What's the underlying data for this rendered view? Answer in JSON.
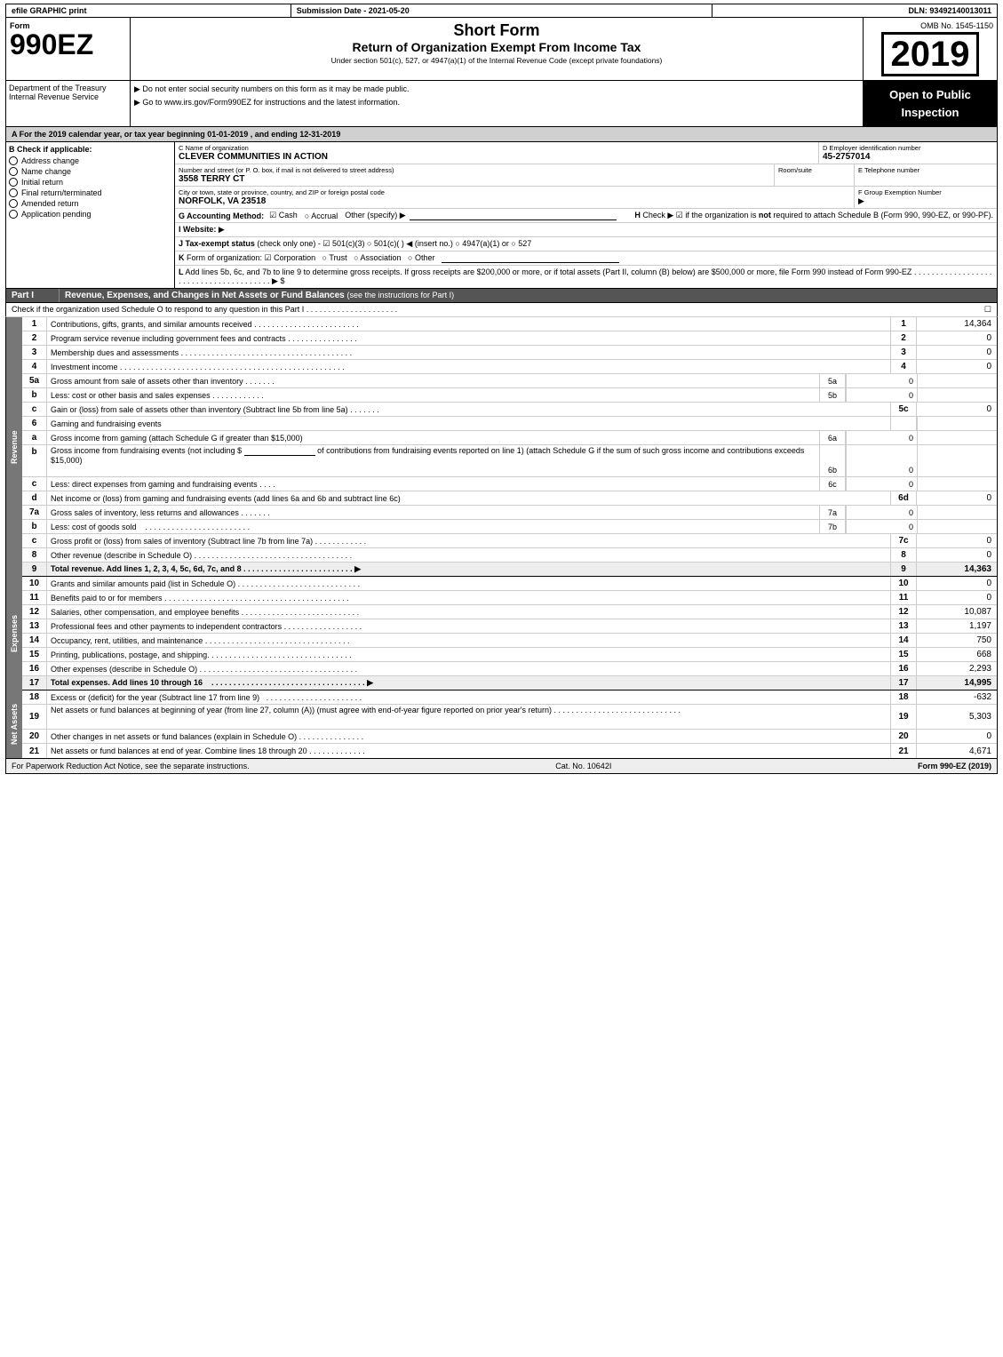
{
  "header": {
    "efile": "efile GRAPHIC print",
    "submission_date_label": "Submission Date - 2021-05-20",
    "dln_label": "DLN: 93492140013011"
  },
  "form": {
    "number": "990EZ",
    "short_form": "Short Form",
    "main_title": "Return of Organization Exempt From Income Tax",
    "subtitle": "Under section 501(c), 527, or 4947(a)(1) of the Internal Revenue Code (except private foundations)",
    "year": "2019",
    "omb": "OMB No. 1545-1150",
    "dept": "Department of the Treasury",
    "irs": "Internal Revenue Service",
    "inst1": "▶ Do not enter social security numbers on this form as it may be made public.",
    "inst2": "▶ Go to www.irs.gov/Form990EZ for instructions and the latest information.",
    "open_public": "Open to Public Inspection"
  },
  "section_a": {
    "text": "A   For the 2019 calendar year, or tax year beginning 01-01-2019 , and ending 12-31-2019"
  },
  "section_b": {
    "label": "B  Check if applicable:",
    "options": [
      {
        "label": "Address change",
        "checked": false
      },
      {
        "label": "Name change",
        "checked": false
      },
      {
        "label": "Initial return",
        "checked": false
      },
      {
        "label": "Final return/terminated",
        "checked": false
      },
      {
        "label": "Amended return",
        "checked": false
      },
      {
        "label": "Application pending",
        "checked": false
      }
    ]
  },
  "org": {
    "name_label": "C Name of organization",
    "name": "CLEVER COMMUNITIES IN ACTION",
    "ein_label": "D Employer identification number",
    "ein": "45-2757014",
    "addr_label": "Number and street (or P. O. box, if mail is not delivered to street address)",
    "addr": "3558 TERRY CT",
    "room_label": "Room/suite",
    "room": "",
    "phone_label": "E Telephone number",
    "phone": "",
    "city_label": "City or town, state or province, country, and ZIP or foreign postal code",
    "city": "NORFOLK, VA  23518",
    "group_label": "F Group Exemption Number",
    "group_num": "▶"
  },
  "section_g": {
    "label": "G Accounting Method:",
    "cash": "☑ Cash",
    "accrual": "○ Accrual",
    "other": "Other (specify) ▶"
  },
  "section_h": {
    "text": "H  Check ▶  ☑ if the organization is not required to attach Schedule B (Form 990, 990-EZ, or 990-PF)."
  },
  "website": {
    "label": "I Website: ▶"
  },
  "section_j": {
    "text": "J Tax-exempt status (check only one) - ☑ 501(c)(3) ○ 501(c)(  )  ◀ (insert no.) ○ 4947(a)(1) or ○ 527"
  },
  "section_k": {
    "text": "K Form of organization: ☑ Corporation  ○ Trust  ○ Association  ○ Other"
  },
  "section_l": {
    "text": "L Add lines 5b, 6c, and 7b to line 9 to determine gross receipts. If gross receipts are $200,000 or more, or if total assets (Part II, column (B) below) are $500,000 or more, file Form 990 instead of Form 990-EZ . . . . . . . . . . . . . . . . . . . . . . . . . . . . . . . . . . . . . . . ▶ $"
  },
  "part1": {
    "header": "Part I",
    "title": "Revenue, Expenses, and Changes in Net Assets or Fund Balances",
    "subtitle": "(see the instructions for Part I)",
    "check_text": "Check if the organization used Schedule O to respond to any question in this Part I . . . . . . . . . . . . . . . . . . . . .",
    "lines": [
      {
        "num": "1",
        "desc": "Contributions, gifts, grants, and similar amounts received . . . . . . . . . . . . . . . . . . . . . . . .",
        "val": "14,364",
        "line_ref": "1"
      },
      {
        "num": "2",
        "desc": "Program service revenue including government fees and contracts . . . . . . . . . . . . . . . .",
        "val": "0",
        "line_ref": "2"
      },
      {
        "num": "3",
        "desc": "Membership dues and assessments . . . . . . . . . . . . . . . . . . . . . . . . . . . . . . . . . . . . . . .",
        "val": "0",
        "line_ref": "3"
      },
      {
        "num": "4",
        "desc": "Investment income . . . . . . . . . . . . . . . . . . . . . . . . . . . . . . . . . . . . . . . . . . . . . . . . . . .",
        "val": "0",
        "line_ref": "4"
      }
    ],
    "line5a": {
      "num": "5a",
      "desc": "Gross amount from sale of assets other than inventory . . . . . . .",
      "box_label": "5a",
      "box_val": "0"
    },
    "line5b": {
      "num": "b",
      "desc": "Less: cost or other basis and sales expenses . . . . . . . . . . . .",
      "box_label": "5b",
      "box_val": "0"
    },
    "line5c": {
      "num": "c",
      "desc": "Gain or (loss) from sale of assets other than inventory (Subtract line 5b from line 5a) . . . . . . .",
      "val": "0",
      "line_ref": "5c"
    },
    "line6_header": {
      "num": "6",
      "desc": "Gaming and fundraising events"
    },
    "line6a": {
      "num": "a",
      "desc": "Gross income from gaming (attach Schedule G if greater than $15,000)",
      "box_label": "6a",
      "box_val": "0"
    },
    "line6b_desc": "Gross income from fundraising events (not including $",
    "line6b_desc2": "of contributions from fundraising events reported on line 1) (attach Schedule G if the sum of such gross income and contributions exceeds $15,000)",
    "line6b": {
      "num": "",
      "box_label": "6b",
      "box_val": "0"
    },
    "line6c": {
      "num": "c",
      "desc": "Less: direct expenses from gaming and fundraising events . . . .",
      "box_label": "6c",
      "box_val": "0"
    },
    "line6d": {
      "num": "d",
      "desc": "Net income or (loss) from gaming and fundraising events (add lines 6a and 6b and subtract line 6c)",
      "val": "0",
      "line_ref": "6d"
    },
    "line7a": {
      "num": "7a",
      "desc": "Gross sales of inventory, less returns and allowances . . . . . . .",
      "box_label": "7a",
      "box_val": "0"
    },
    "line7b": {
      "num": "b",
      "desc": "Less: cost of goods sold . . . . . . . . . . . . . . . . . . . . . . . .",
      "box_label": "7b",
      "box_val": "0"
    },
    "line7c": {
      "num": "c",
      "desc": "Gross profit or (loss) from sales of inventory (Subtract line 7b from line 7a) . . . . . . . . . . . .",
      "val": "0",
      "line_ref": "7c"
    },
    "line8": {
      "num": "8",
      "desc": "Other revenue (describe in Schedule O) . . . . . . . . . . . . . . . . . . . . . . . . . . . . . . . . . . . .",
      "val": "0",
      "line_ref": "8"
    },
    "line9": {
      "num": "9",
      "desc": "Total revenue. Add lines 1, 2, 3, 4, 5c, 6d, 7c, and 8 . . . . . . . . . . . . . . . . . . . . . . . . . ▶",
      "val": "14,363",
      "line_ref": "9",
      "bold": true
    },
    "revenue_label": "Revenue"
  },
  "expenses": {
    "label": "Expenses",
    "lines": [
      {
        "num": "10",
        "desc": "Grants and similar amounts paid (list in Schedule O) . . . . . . . . . . . . . . . . . . . . . . . . . . . .",
        "val": "0",
        "line_ref": "10"
      },
      {
        "num": "11",
        "desc": "Benefits paid to or for members . . . . . . . . . . . . . . . . . . . . . . . . . . . . . . . . . . . . . . . . . .",
        "val": "0",
        "line_ref": "11"
      },
      {
        "num": "12",
        "desc": "Salaries, other compensation, and employee benefits . . . . . . . . . . . . . . . . . . . . . . . . . . .",
        "val": "10,087",
        "line_ref": "12"
      },
      {
        "num": "13",
        "desc": "Professional fees and other payments to independent contractors . . . . . . . . . . . . . . . . . .",
        "val": "1,197",
        "line_ref": "13"
      },
      {
        "num": "14",
        "desc": "Occupancy, rent, utilities, and maintenance . . . . . . . . . . . . . . . . . . . . . . . . . . . . . . . . .",
        "val": "750",
        "line_ref": "14"
      },
      {
        "num": "15",
        "desc": "Printing, publications, postage, and shipping. . . . . . . . . . . . . . . . . . . . . . . . . . . . . . . . .",
        "val": "668",
        "line_ref": "15"
      },
      {
        "num": "16",
        "desc": "Other expenses (describe in Schedule O) . . . . . . . . . . . . . . . . . . . . . . . . . . . . . . . . . . .",
        "val": "2,293",
        "line_ref": "16"
      },
      {
        "num": "17",
        "desc": "Total expenses. Add lines 10 through 16 . . . . . . . . . . . . . . . . . . . . . . . . . . . . . . . . . . ▶",
        "val": "14,995",
        "line_ref": "17",
        "bold": true
      }
    ]
  },
  "net_assets": {
    "label": "Net Assets",
    "lines": [
      {
        "num": "18",
        "desc": "Excess or (deficit) for the year (Subtract line 17 from line 9) . . . . . . . . . . . . . . . . . . . . . .",
        "val": "-632",
        "line_ref": "18"
      },
      {
        "num": "19",
        "desc": "Net assets or fund balances at beginning of year (from line 27, column (A)) (must agree with end-of-year figure reported on prior year's return) . . . . . . . . . . . . . . . . . . . . . . . . . . . . .",
        "val": "5,303",
        "line_ref": "19"
      },
      {
        "num": "20",
        "desc": "Other changes in net assets or fund balances (explain in Schedule O) . . . . . . . . . . . . . . .",
        "val": "0",
        "line_ref": "20"
      },
      {
        "num": "21",
        "desc": "Net assets or fund balances at end of year. Combine lines 18 through 20 . . . . . . . . . . . . .",
        "val": "4,671",
        "line_ref": "21"
      }
    ]
  },
  "footer": {
    "paperwork": "For Paperwork Reduction Act Notice, see the separate instructions.",
    "cat_no": "Cat. No. 10642I",
    "form_ref": "Form 990-EZ (2019)"
  }
}
